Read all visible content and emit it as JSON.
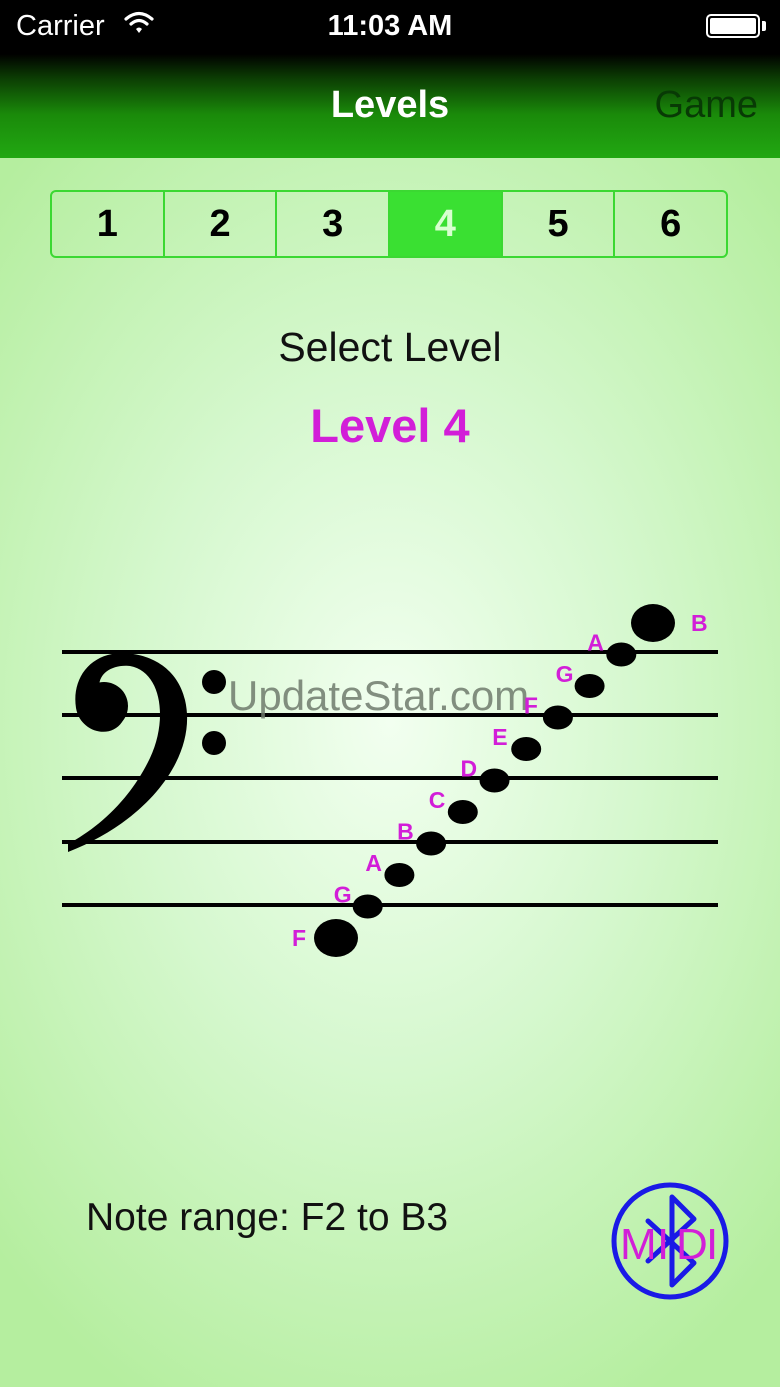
{
  "status_bar": {
    "carrier": "Carrier",
    "time": "11:03 AM"
  },
  "nav": {
    "title": "Levels",
    "right_button": "Game"
  },
  "levels": {
    "segments": [
      "1",
      "2",
      "3",
      "4",
      "5",
      "6"
    ],
    "selected": "4"
  },
  "select_label": "Select Level",
  "level_label": "Level 4",
  "staff": {
    "clef": "bass-clef",
    "notes": [
      "F",
      "G",
      "A",
      "B",
      "C",
      "D",
      "E",
      "F",
      "G",
      "A",
      "B"
    ]
  },
  "watermark": "UpdateStar.com",
  "note_range": "Note range:  F2 to B3",
  "midi_badge": {
    "icon": "bluetooth-midi-icon",
    "letters": [
      "M",
      "I",
      "D",
      "I"
    ]
  },
  "colors": {
    "accent_green": "#3ae032",
    "note_label_magenta": "#d21ed8",
    "midi_blue": "#1a1ae6"
  }
}
